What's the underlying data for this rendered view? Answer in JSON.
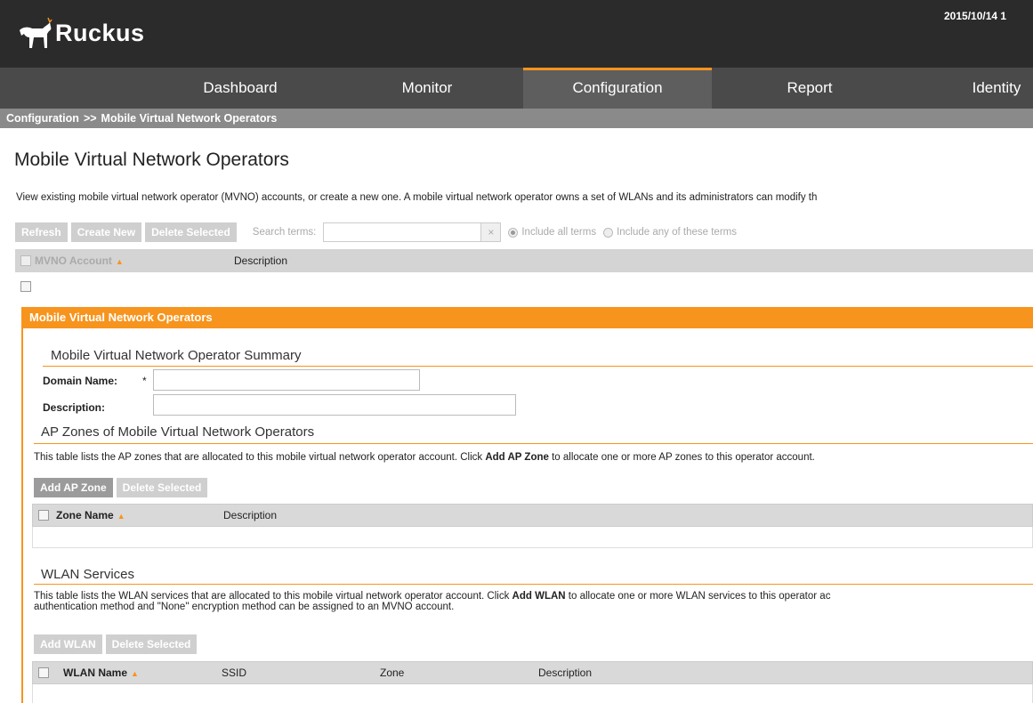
{
  "header": {
    "brand": "Ruckus",
    "datetime": "2015/10/14 1"
  },
  "nav": {
    "items": [
      {
        "label": "Dashboard"
      },
      {
        "label": "Monitor"
      },
      {
        "label": "Configuration"
      },
      {
        "label": "Report"
      },
      {
        "label": "Identity"
      }
    ],
    "active": "Configuration"
  },
  "breadcrumb": {
    "root": "Configuration",
    "separator": ">>",
    "current": "Mobile Virtual Network Operators"
  },
  "page": {
    "title": "Mobile Virtual Network Operators",
    "intro": "View existing mobile virtual network operator (MVNO) accounts, or create a new one. A mobile virtual network operator owns a set of WLANs and its administrators can modify th"
  },
  "toolbar": {
    "refresh": "Refresh",
    "create_new": "Create New",
    "delete_selected": "Delete Selected",
    "search_label": "Search terms:",
    "search_value": "",
    "clear_symbol": "×",
    "radio_all": "Include all terms",
    "radio_any": "Include any of these terms"
  },
  "grid": {
    "columns": [
      "MVNO Account",
      "Description"
    ],
    "sort_symbol": "▲"
  },
  "panel": {
    "title": "Mobile Virtual Network Operators",
    "summary": {
      "title": "Mobile Virtual Network Operator Summary",
      "domain_label": "Domain Name:",
      "required": "*",
      "domain_value": "",
      "description_label": "Description:",
      "description_value": ""
    },
    "ap_zones": {
      "title": "AP Zones of Mobile Virtual Network Operators",
      "help_pre": "This table lists the AP zones that are allocated to this mobile virtual network operator account. Click ",
      "help_bold": "Add AP Zone",
      "help_post": " to allocate one or more AP zones to this operator account.",
      "add_button": "Add AP Zone",
      "delete_button": "Delete Selected",
      "columns": [
        "Zone Name",
        "Description"
      ]
    },
    "wlan": {
      "title": "WLAN Services",
      "help_pre": "This table lists the WLAN services that are allocated to this mobile virtual network operator account. Click ",
      "help_bold": "Add WLAN",
      "help_post": " to allocate one or more WLAN services to this operator ac",
      "help_line2": "authentication method and \"None\" encryption method can be assigned to an MVNO account.",
      "add_button": "Add WLAN",
      "delete_button": "Delete Selected",
      "columns": [
        "WLAN Name",
        "SSID",
        "Zone",
        "Description"
      ]
    }
  },
  "colors": {
    "accent": "#f7941d",
    "header_bg": "#2b2b2b",
    "nav_bg": "#4a4a4a",
    "breadcrumb_bg": "#8a8a8a"
  }
}
